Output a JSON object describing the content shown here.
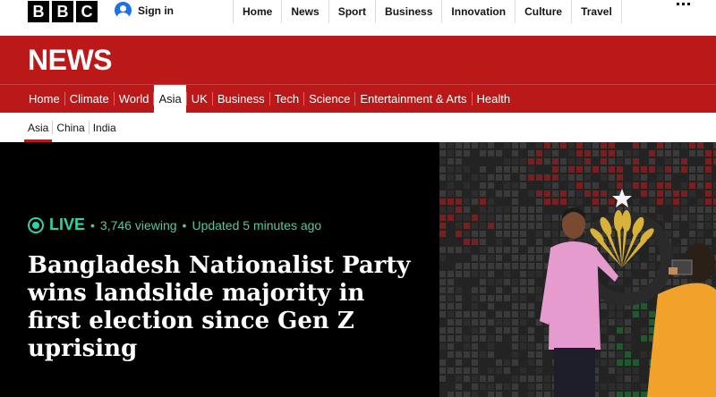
{
  "brand": {
    "letters": [
      "B",
      "B",
      "C"
    ]
  },
  "account": {
    "signin_label": "Sign in"
  },
  "top_nav": [
    "Home",
    "News",
    "Sport",
    "Business",
    "Innovation",
    "Culture",
    "Travel"
  ],
  "section": {
    "title": "NEWS"
  },
  "section_nav": [
    "Home",
    "Climate",
    "World",
    "Asia",
    "UK",
    "Business",
    "Tech",
    "Science",
    "Entertainment & Arts",
    "Health"
  ],
  "section_nav_active": "Asia",
  "sub_nav": [
    "Asia",
    "China",
    "India"
  ],
  "sub_nav_active": "Asia",
  "hero": {
    "live_label": "LIVE",
    "viewing": "3,746 viewing",
    "updated": "Updated 5 minutes ago",
    "headline": "Bangladesh Nationalist Party wins landslide majority in first election since Gen Z uprising"
  },
  "colors": {
    "brand_red": "#bb1919",
    "live_green": "#2fd3a6"
  },
  "icons": {
    "account": "user-avatar-icon",
    "menu": "menu-dots-icon",
    "live": "live-indicator-icon"
  }
}
